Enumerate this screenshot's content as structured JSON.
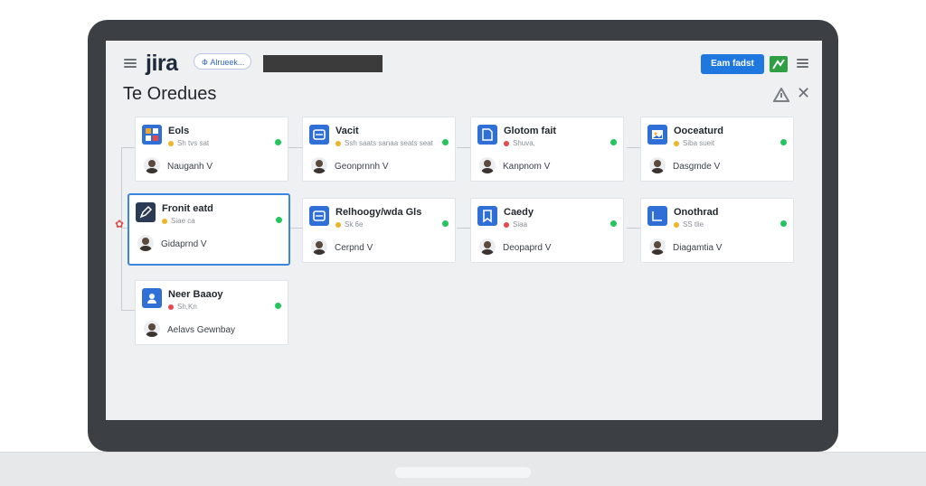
{
  "header": {
    "logo": "jira",
    "search_label": "Ф Alrueek...",
    "primary_button": "Eam fadst",
    "page_title": "Te Oredues"
  },
  "colors": {
    "accent": "#1f78e0",
    "selected_border": "#3a86e0",
    "status_green": "#22c55e",
    "status_yellow": "#f0b429",
    "status_red": "#e5484d"
  },
  "cards": [
    {
      "title": "Eols",
      "sub": "Sh tvs sat",
      "sub_color": "yellow",
      "assignee": "Nauganh V",
      "icon": "board-icon"
    },
    {
      "title": "Vacit",
      "sub": "Ssh saats sanaa seats seat",
      "sub_color": "yellow",
      "assignee": "Geonprnnh V",
      "icon": "task-icon"
    },
    {
      "title": "Glotom fait",
      "sub": "Shuva,",
      "sub_color": "red",
      "assignee": "Kanpnom V",
      "icon": "document-icon"
    },
    {
      "title": "Ooceaturd",
      "sub": "Siba sueit",
      "sub_color": "yellow",
      "assignee": "Dasgmde V",
      "icon": "image-icon"
    },
    {
      "title": "Fronit eatd",
      "sub": "Siae ca",
      "sub_color": "yellow",
      "assignee": "Gidaprnd V",
      "icon": "edit-icon"
    },
    {
      "title": "Relhoogy/wda Gls",
      "sub": "Sk 6e",
      "sub_color": "yellow",
      "assignee": "Cerpnd V",
      "icon": "task-icon"
    },
    {
      "title": "Caedy",
      "sub": "Siaa",
      "sub_color": "red",
      "assignee": "Deopaprd V",
      "icon": "bookmark-icon"
    },
    {
      "title": "Onothrad",
      "sub": "SS tlie",
      "sub_color": "yellow",
      "assignee": "Diagamtia V",
      "icon": "chart-icon"
    },
    {
      "title": "Neer Baaoy",
      "sub": "Sh,Kn",
      "sub_color": "red",
      "assignee": "Aelavs Gewnbay",
      "icon": "user-icon"
    }
  ]
}
